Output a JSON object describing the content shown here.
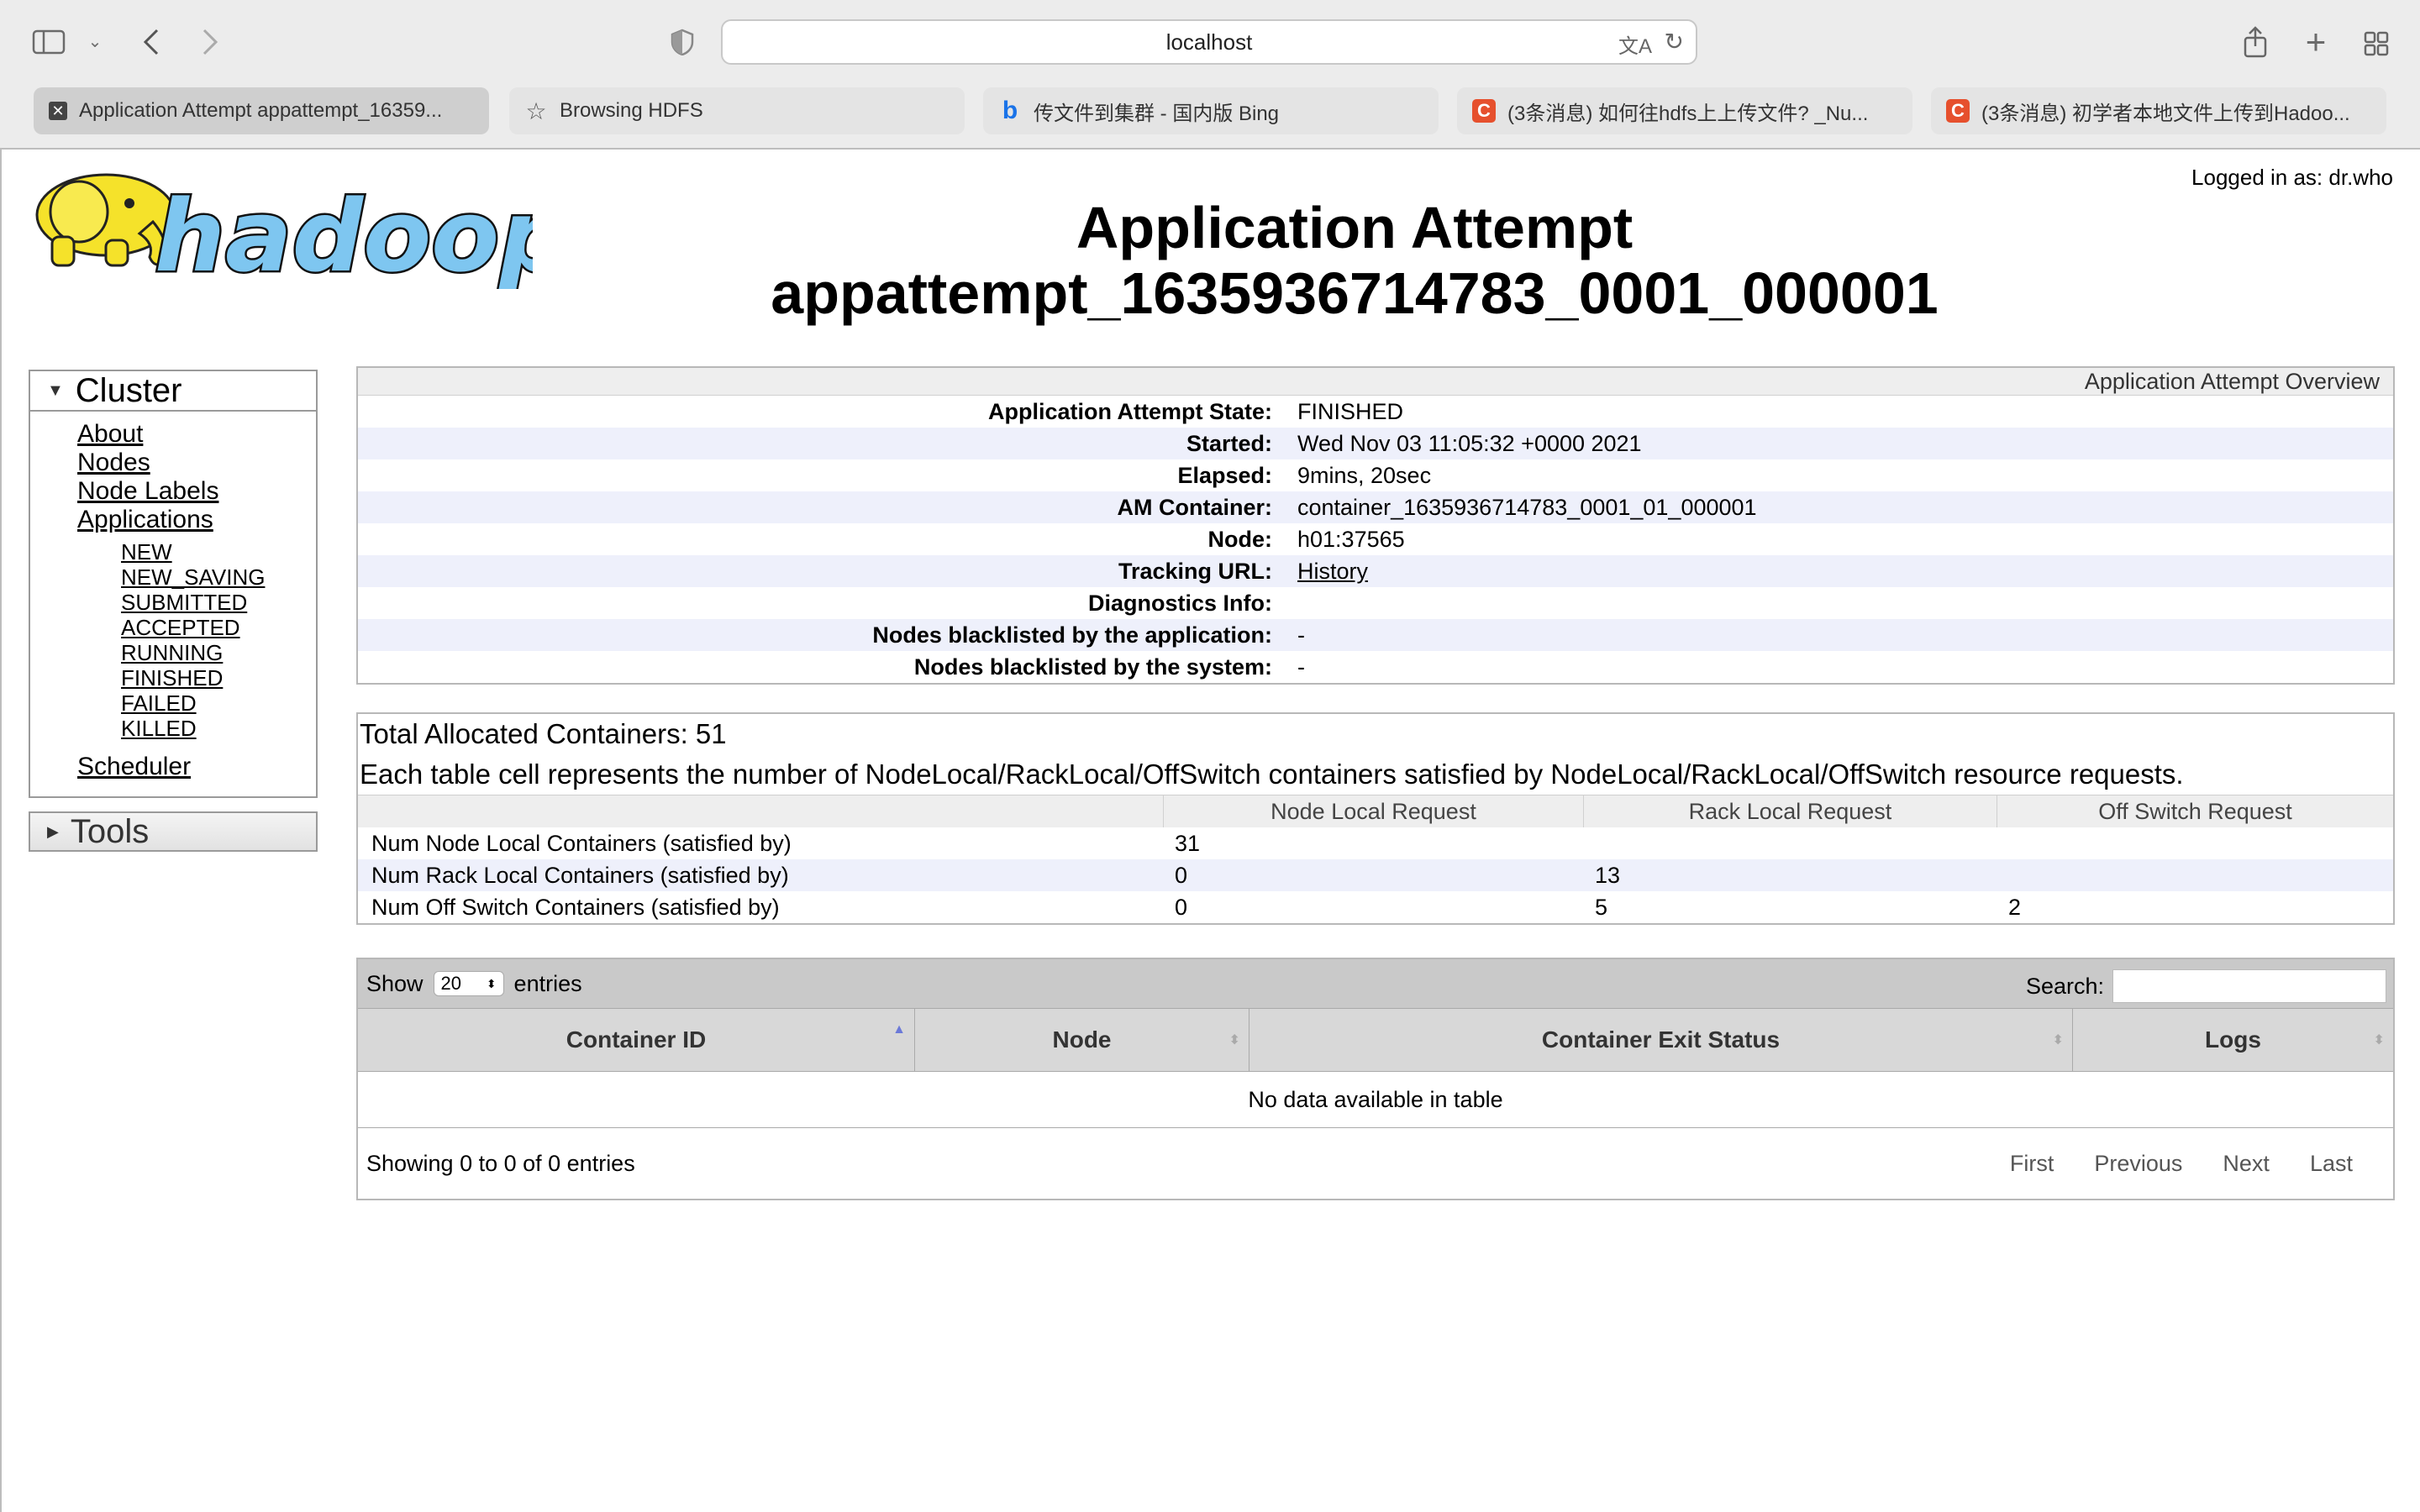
{
  "browser": {
    "address": "localhost",
    "tabs": [
      {
        "title": "Application Attempt appattempt_16359...",
        "active": true,
        "icon": "close-icon"
      },
      {
        "title": "Browsing HDFS",
        "active": false,
        "icon": "star-icon"
      },
      {
        "title": "传文件到集群 - 国内版 Bing",
        "active": false,
        "icon": "bing-icon"
      },
      {
        "title": "(3条消息) 如何往hdfs上上传文件? _Nu...",
        "active": false,
        "icon": "csdn-icon"
      },
      {
        "title": "(3条消息) 初学者本地文件上传到Hadoo...",
        "active": false,
        "icon": "csdn-icon"
      }
    ]
  },
  "header": {
    "logged_in": "Logged in as: dr.who",
    "logo_text": "hadoop",
    "title_line1": "Application Attempt",
    "title_line2": "appattempt_1635936714783_0001_000001"
  },
  "sidebar": {
    "cluster_label": "Cluster",
    "links": [
      "About",
      "Nodes",
      "Node Labels",
      "Applications"
    ],
    "app_states": [
      "NEW",
      "NEW_SAVING",
      "SUBMITTED",
      "ACCEPTED",
      "RUNNING",
      "FINISHED",
      "FAILED",
      "KILLED"
    ],
    "scheduler": "Scheduler",
    "tools_label": "Tools"
  },
  "overview": {
    "heading": "Application Attempt Overview",
    "rows": [
      {
        "key": "Application Attempt State:",
        "value": "FINISHED"
      },
      {
        "key": "Started:",
        "value": "Wed Nov 03 11:05:32 +0000 2021"
      },
      {
        "key": "Elapsed:",
        "value": "9mins, 20sec"
      },
      {
        "key": "AM Container:",
        "value": "container_1635936714783_0001_01_000001"
      },
      {
        "key": "Node:",
        "value": "h01:37565"
      },
      {
        "key": "Tracking URL:",
        "value": "History"
      },
      {
        "key": "Diagnostics Info:",
        "value": ""
      },
      {
        "key": "Nodes blacklisted by the application:",
        "value": "-"
      },
      {
        "key": "Nodes blacklisted by the system:",
        "value": "-"
      }
    ]
  },
  "containers": {
    "total": "Total Allocated Containers: 51",
    "description": "Each table cell represents the number of NodeLocal/RackLocal/OffSwitch containers satisfied by NodeLocal/RackLocal/OffSwitch resource requests.",
    "columns": [
      "",
      "Node Local Request",
      "Rack Local Request",
      "Off Switch Request"
    ],
    "rows": [
      [
        "Num Node Local Containers (satisfied by)",
        "31",
        "",
        ""
      ],
      [
        "Num Rack Local Containers (satisfied by)",
        "0",
        "13",
        ""
      ],
      [
        "Num Off Switch Containers (satisfied by)",
        "0",
        "5",
        "2"
      ]
    ]
  },
  "datatable": {
    "show": "Show",
    "page_size": "20",
    "entries": "entries",
    "search_label": "Search:",
    "columns": [
      "Container ID",
      "Node",
      "Container Exit Status",
      "Logs"
    ],
    "empty": "No data available in table",
    "info": "Showing 0 to 0 of 0 entries",
    "pager": [
      "First",
      "Previous",
      "Next",
      "Last"
    ]
  },
  "colors": {
    "logo_elephant": "#f5e22a",
    "logo_text_fill": "#7ec6f0",
    "alt_row": "#eef0fb",
    "csdn_red": "#e6502d"
  }
}
